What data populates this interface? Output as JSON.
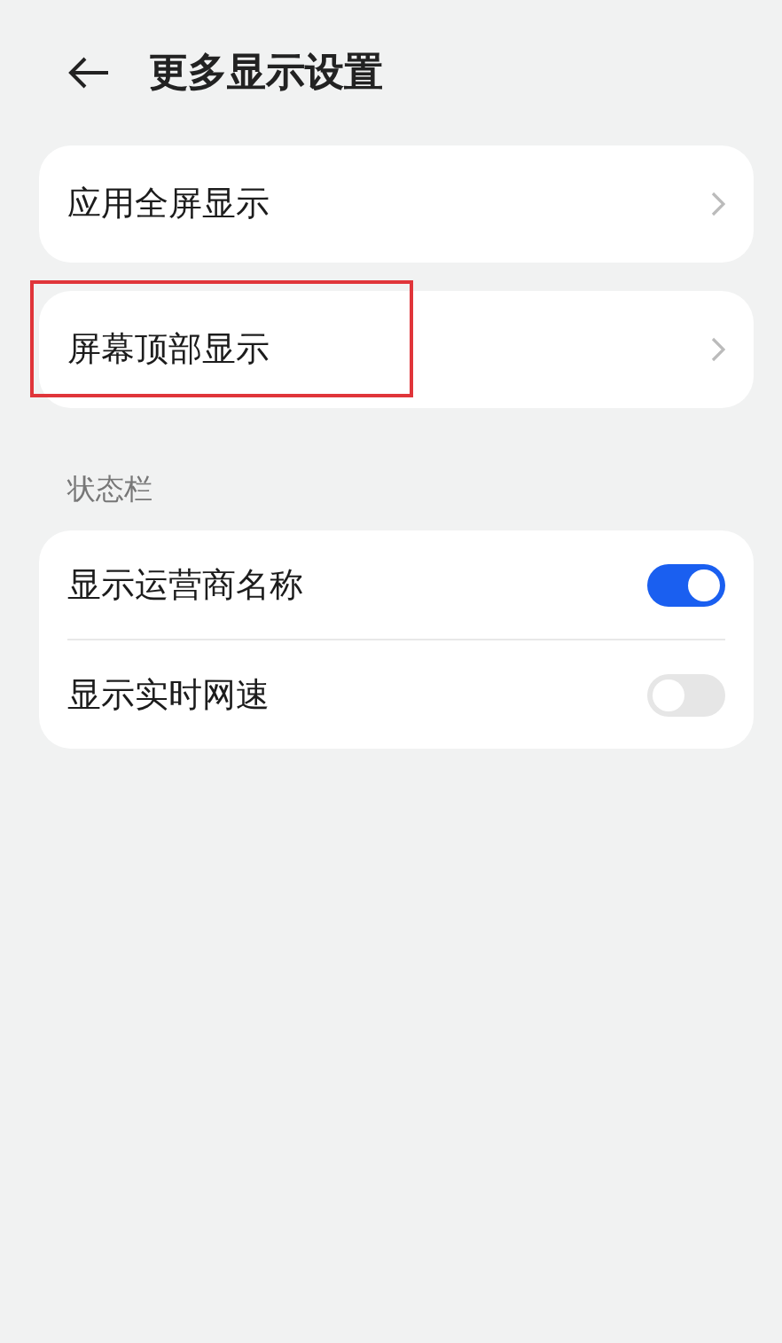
{
  "header": {
    "title": "更多显示设置"
  },
  "nav_cards": [
    {
      "label": "应用全屏显示",
      "highlighted": false
    },
    {
      "label": "屏幕顶部显示",
      "highlighted": true
    }
  ],
  "section": {
    "title": "状态栏",
    "rows": [
      {
        "label": "显示运营商名称",
        "on": true
      },
      {
        "label": "显示实时网速",
        "on": false
      }
    ]
  }
}
